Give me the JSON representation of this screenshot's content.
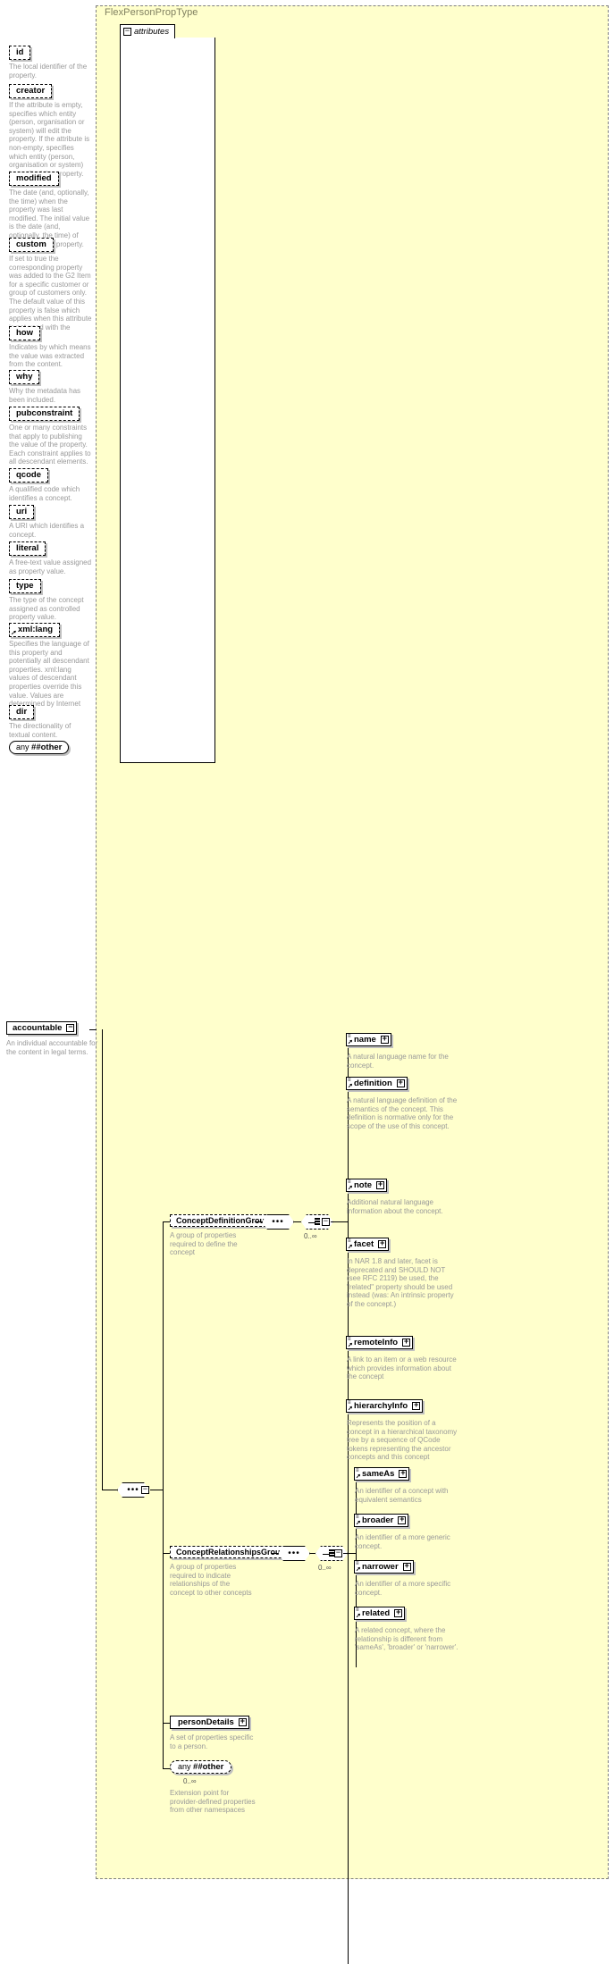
{
  "type_panel": {
    "title": "FlexPersonPropType"
  },
  "attributes_panel": {
    "tab_label": "attributes",
    "collapse_glyph": "−",
    "items": [
      {
        "name": "id",
        "desc": "The local identifier of the property."
      },
      {
        "name": "creator",
        "desc": "If the attribute is empty, specifies which entity (person, organisation or system) will edit the property. If the attribute is non-empty, specifies which entity (person, organisation or system) has edited the property."
      },
      {
        "name": "modified",
        "desc": "The date (and, optionally, the time) when the property was last modified. The initial value is the date (and, optionally, the time) of creation of the property."
      },
      {
        "name": "custom",
        "desc": "If set to true the corresponding property was added to the G2 Item for a specific customer or group of customers only. The default value of this property is false which applies when this attribute is not used with the property."
      },
      {
        "name": "how",
        "desc": "Indicates by which means the value was extracted from the content."
      },
      {
        "name": "why",
        "desc": "Why the metadata has been included."
      },
      {
        "name": "pubconstraint",
        "desc": "One or many constraints that apply to publishing the value of the property. Each constraint applies to all descendant elements."
      },
      {
        "name": "qcode",
        "desc": "A qualified code which identifies a concept."
      },
      {
        "name": "uri",
        "desc": "A URI which identifies a concept."
      },
      {
        "name": "literal",
        "desc": "A free-text value assigned as property value."
      },
      {
        "name": "type",
        "desc": "The type of the concept assigned as controlled property value."
      },
      {
        "name": "xml:lang",
        "desc": "Specifies the language of this property and potentially all descendant properties. xml:lang values of descendant properties override this value. Values are determined by Internet BCP 47."
      },
      {
        "name": "dir",
        "desc": "The directionality of textual content."
      }
    ],
    "any_attribute": {
      "prefix": "any",
      "namespace": "##other"
    }
  },
  "root_element": {
    "name": "accountable",
    "desc": "An individual accountable for the content in legal terms.",
    "collapse_glyph": "−"
  },
  "connectors": {
    "sequence_glyph": "•••",
    "expand_glyph": "+",
    "collapse_glyph": "−",
    "cardinality": "0..∞"
  },
  "groups": [
    {
      "name": "ConceptDefinitionGroup",
      "desc": "A group of properties required to define the concept",
      "cardinality": "0..∞",
      "elements": [
        {
          "name": "name",
          "desc": "A natural language name for the concept."
        },
        {
          "name": "definition",
          "desc": "A natural language definition of the semantics of the concept. This definition is normative only for the scope of the use of this concept."
        },
        {
          "name": "note",
          "desc": "Additional natural language information about the concept."
        },
        {
          "name": "facet",
          "desc": "In NAR 1.8 and later, facet is deprecated and SHOULD NOT (see RFC 2119) be used, the \"related\" property should be used instead (was: An intrinsic property of the concept.)"
        },
        {
          "name": "remoteInfo",
          "desc": "A link to an item or a web resource which provides information about the concept"
        },
        {
          "name": "hierarchyInfo",
          "desc": "Represents the position of a concept in a hierarchical taxonomy tree by a sequence of QCode tokens representing the ancestor concepts and this concept"
        }
      ]
    },
    {
      "name": "ConceptRelationshipsGroup",
      "desc": "A group of properties required to indicate relationships of the concept to other concepts",
      "cardinality": "0..∞",
      "elements": [
        {
          "name": "sameAs",
          "desc": "An identifier of a concept with equivalent semantics"
        },
        {
          "name": "broader",
          "desc": "An identifier of a more generic concept."
        },
        {
          "name": "narrower",
          "desc": "An identifier of a more specific concept."
        },
        {
          "name": "related",
          "desc": "A related concept, where the relationship is different from 'sameAs', 'broader' or 'narrower'."
        }
      ]
    }
  ],
  "extra_elements": [
    {
      "name": "personDetails",
      "desc": "A set of properties specific to a person."
    }
  ],
  "any_element": {
    "prefix": "any",
    "namespace": "##other",
    "cardinality": "0..∞",
    "desc": "Extension point for provider-defined properties from other namespaces"
  },
  "colors": {
    "panel_background": "#ffffcc",
    "panel_border": "#808080",
    "title_text": "#808060",
    "description_text": "#999999",
    "box_shadow": "#c0c0c0",
    "line": "#000000"
  }
}
